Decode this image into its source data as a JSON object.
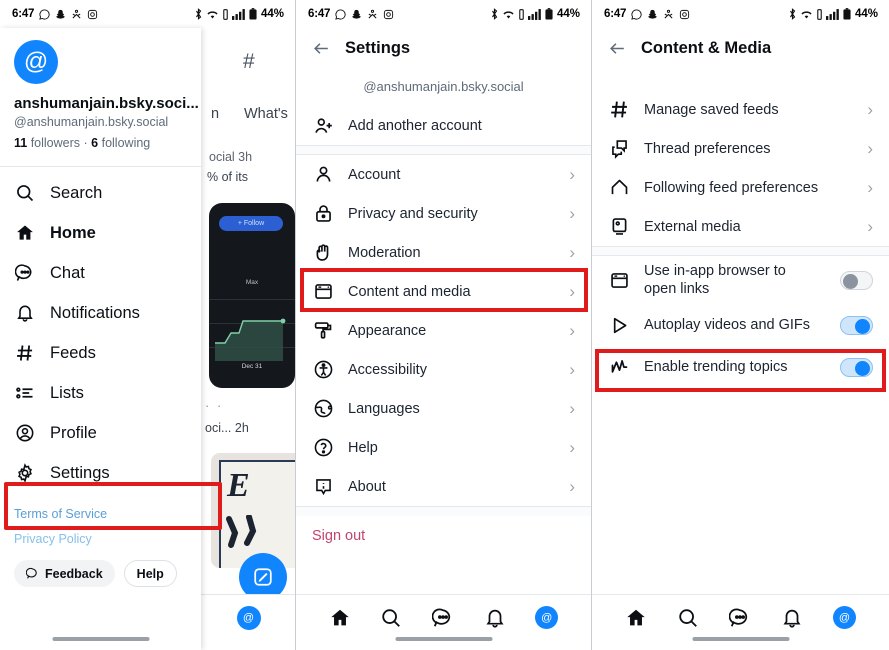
{
  "status_bar": {
    "time": "6:47",
    "left_icons": [
      "whatsapp-icon",
      "snapchat-icon",
      "contacts-icon",
      "instagram-icon"
    ],
    "right_icons": [
      "bluetooth-icon",
      "wifi-icon",
      "vibrate-icon",
      "signal-icon",
      "battery-icon"
    ],
    "battery": "44%"
  },
  "panel1": {
    "profile": {
      "avatar_glyph": "@",
      "display_name": "anshumanjain.bsky.soci...",
      "handle": "@anshumanjain.bsky.social",
      "followers_count": "11",
      "followers_label": "followers",
      "separator": "·",
      "following_count": "6",
      "following_label": "following"
    },
    "nav": [
      {
        "label": "Search",
        "icon": "search-icon",
        "active": false
      },
      {
        "label": "Home",
        "icon": "home-icon",
        "active": true
      },
      {
        "label": "Chat",
        "icon": "chat-icon",
        "active": false
      },
      {
        "label": "Notifications",
        "icon": "bell-icon",
        "active": false
      },
      {
        "label": "Feeds",
        "icon": "hash-icon",
        "active": false
      },
      {
        "label": "Lists",
        "icon": "list-icon",
        "active": false
      },
      {
        "label": "Profile",
        "icon": "person-circle-icon",
        "active": false
      },
      {
        "label": "Settings",
        "icon": "gear-icon",
        "active": false
      }
    ],
    "legal": {
      "terms": "Terms of Service",
      "privacy": "Privacy Policy"
    },
    "buttons": {
      "feedback": "Feedback",
      "help": "Help"
    },
    "highlight": "Settings",
    "background_feed": {
      "hash": "#",
      "whats": "What's",
      "n_char": "n",
      "line1": "ocial  3h",
      "line2": "% of its",
      "follow_button": "+ Follow",
      "card_max_label": "Max",
      "card_date_label": "Dec 31",
      "dots": "· ·",
      "line3": "oci... 2h",
      "photo_letter": "E",
      "compose_icon": "compose-icon",
      "avatar_glyph": "@"
    }
  },
  "panel2": {
    "title": "Settings",
    "back_icon": "back-arrow-icon",
    "account_handle": "@anshumanjain.bsky.social",
    "add_account": {
      "label": "Add another account",
      "icon": "add-person-icon"
    },
    "items": [
      {
        "label": "Account",
        "icon": "person-icon"
      },
      {
        "label": "Privacy and security",
        "icon": "lock-icon"
      },
      {
        "label": "Moderation",
        "icon": "hand-icon"
      },
      {
        "label": "Content and media",
        "icon": "window-icon",
        "highlighted": true
      },
      {
        "label": "Appearance",
        "icon": "paint-roller-icon"
      },
      {
        "label": "Accessibility",
        "icon": "accessibility-icon"
      },
      {
        "label": "Languages",
        "icon": "globe-icon"
      },
      {
        "label": "Help",
        "icon": "question-icon"
      },
      {
        "label": "About",
        "icon": "info-icon"
      }
    ],
    "sign_out": "Sign out",
    "chevron": "›",
    "highlight": "Content and media"
  },
  "panel3": {
    "title": "Content & Media",
    "back_icon": "back-arrow-icon",
    "items": [
      {
        "label": "Manage saved feeds",
        "icon": "hash-icon"
      },
      {
        "label": "Thread preferences",
        "icon": "threads-icon"
      },
      {
        "label": "Following feed preferences",
        "icon": "home-outline-icon"
      },
      {
        "label": "External media",
        "icon": "external-media-icon"
      }
    ],
    "toggles": [
      {
        "label": "Use in-app browser to open links",
        "icon": "window-icon",
        "state": "off"
      },
      {
        "label": "Autoplay videos and GIFs",
        "icon": "play-icon",
        "state": "on"
      },
      {
        "label": "Enable trending topics",
        "icon": "trending-icon",
        "state": "on",
        "highlighted": true
      }
    ],
    "chevron": "›",
    "highlight": "Enable trending topics"
  },
  "tabbar": {
    "items": [
      "home-icon",
      "search-icon",
      "chat-icon",
      "bell-icon",
      "avatar-icon"
    ],
    "avatar_glyph": "@"
  },
  "colors": {
    "accent": "#1185fe",
    "highlight": "#e01b1b",
    "sign_out": "#c3436b",
    "link": "#5a9fd4",
    "muted": "#5e6b79"
  }
}
